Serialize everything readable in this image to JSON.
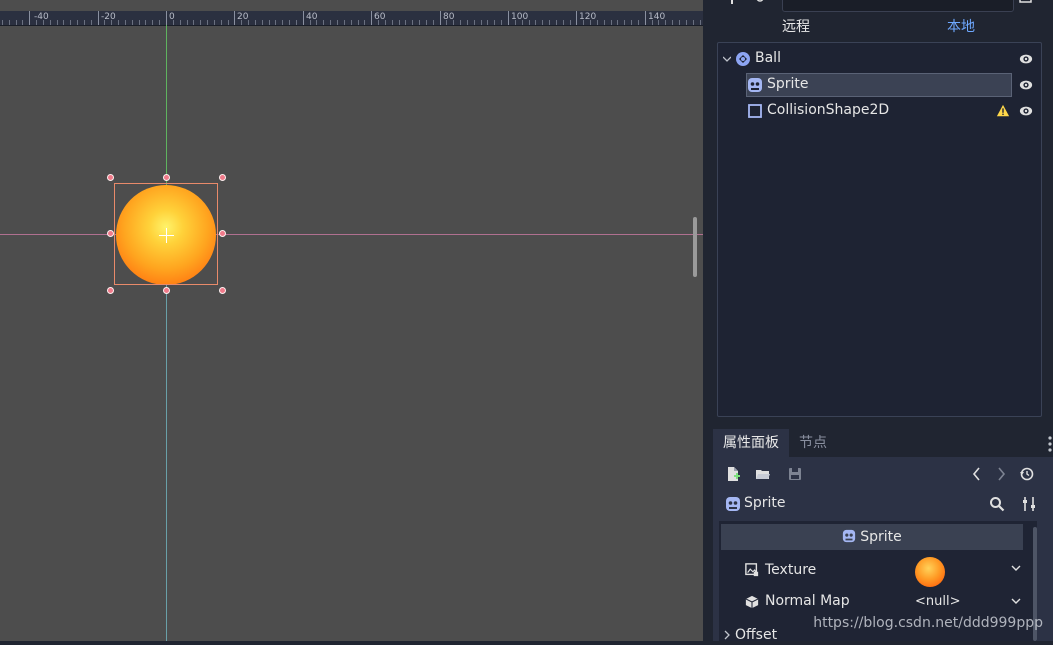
{
  "ruler": {
    "labels": [
      "-40",
      "-20",
      "0",
      "20",
      "40",
      "60",
      "80",
      "100",
      "120",
      "140"
    ]
  },
  "scene_dock": {
    "filter_placeholder": "",
    "tabs": {
      "remote": "远程",
      "local": "本地"
    },
    "tree": [
      {
        "label": "Ball",
        "icon": "node2d-icon",
        "visible": true
      },
      {
        "label": "Sprite",
        "icon": "sprite-icon",
        "visible": true,
        "selected": true
      },
      {
        "label": "CollisionShape2D",
        "icon": "collision-shape-icon",
        "visible": true,
        "warning": true
      }
    ]
  },
  "inspector": {
    "tabs": {
      "inspector": "属性面板",
      "node": "节点"
    },
    "object_name": "Sprite",
    "category": "Sprite",
    "properties": [
      {
        "label": "Texture",
        "value": ""
      },
      {
        "label": "Normal Map",
        "value": "<null>"
      }
    ],
    "section": "Offset"
  },
  "watermark": "https://blog.csdn.net/ddd999ppp",
  "colors": {
    "accent": "#6ea8ff",
    "viewport_bg": "#4d4d4d",
    "panel_bg": "#202531"
  }
}
